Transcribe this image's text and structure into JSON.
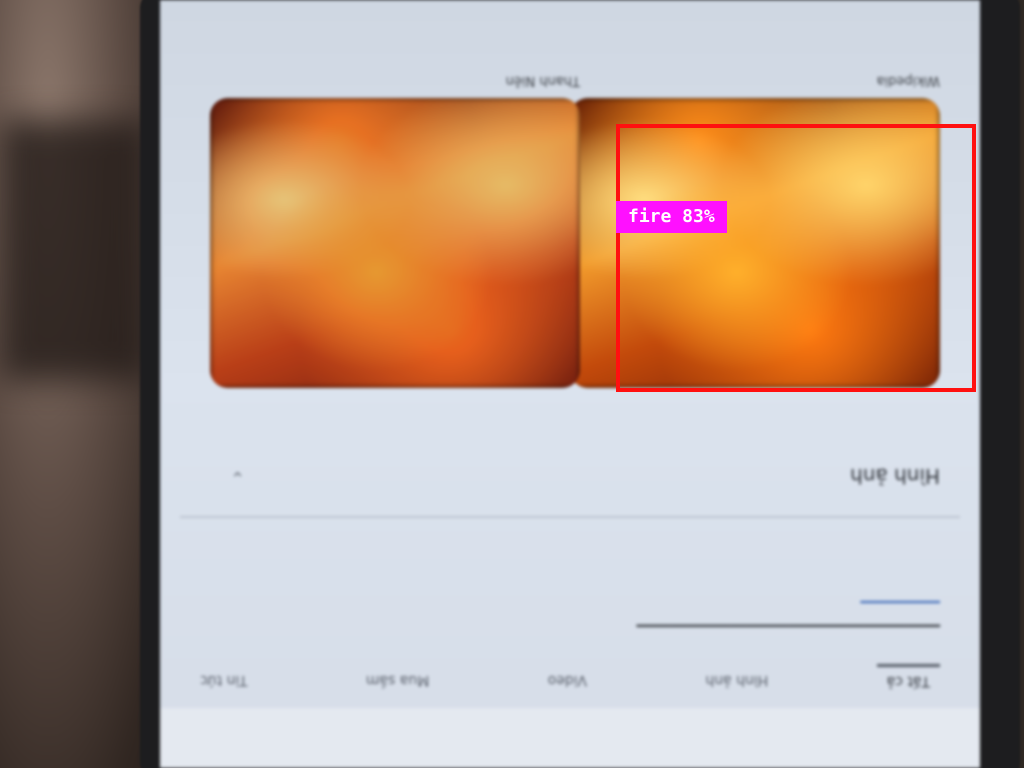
{
  "detection": {
    "label": "fire 83%",
    "class": "fire",
    "confidence_percent": 83,
    "box_color": "#ff1010",
    "label_bg_color": "#ff10ff"
  },
  "phone_screen": {
    "tabs": [
      "Tất cả",
      "Hình ảnh",
      "Video",
      "Mua sắm",
      "Tin tức"
    ],
    "section_title": "Hình ảnh",
    "cards": [
      {
        "meta": "Wikipedia"
      },
      {
        "meta": "Thanh Niên"
      }
    ]
  }
}
